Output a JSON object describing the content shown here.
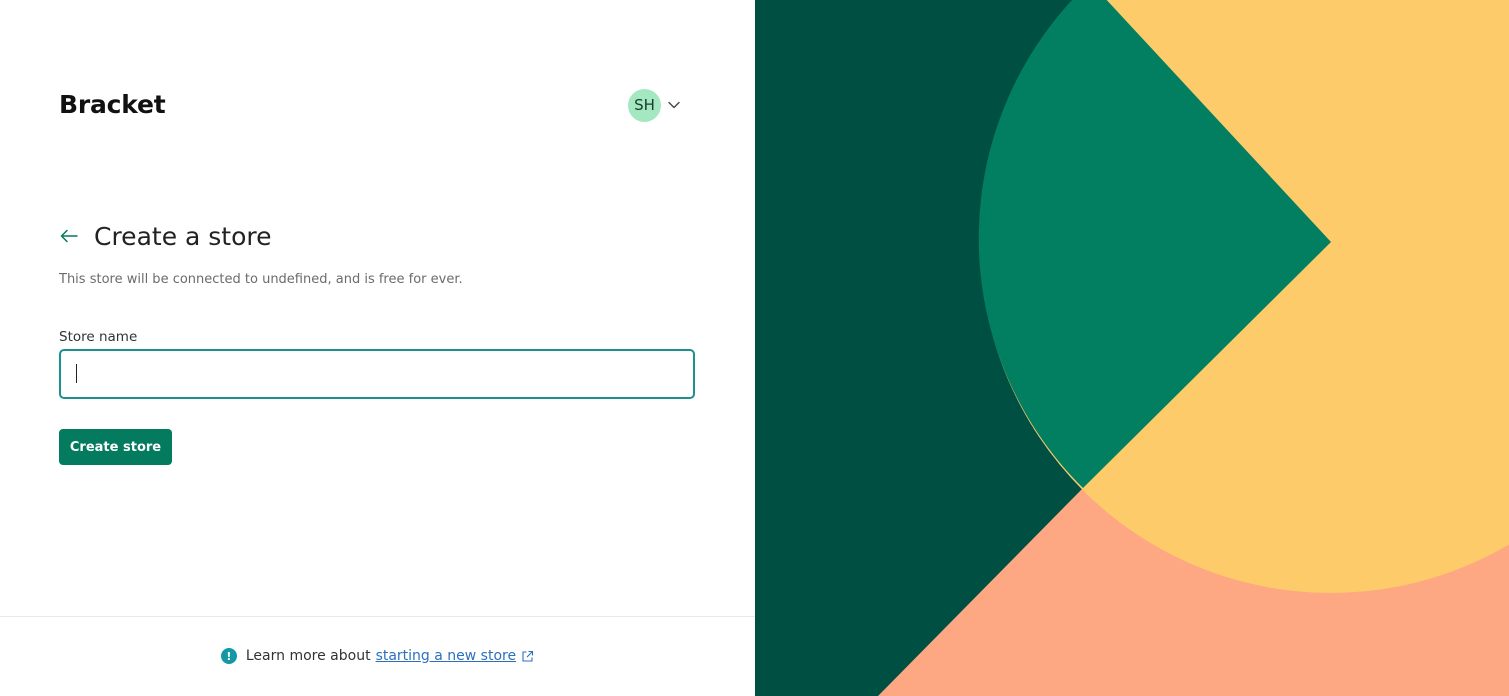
{
  "header": {
    "brand": "Bracket",
    "avatar_initials": "SH"
  },
  "main": {
    "title": "Create a store",
    "subtitle": "This store will be connected to undefined, and is free for ever.",
    "store_name_label": "Store name",
    "store_name_value": "",
    "store_name_placeholder": "",
    "submit_label": "Create store"
  },
  "footer": {
    "prefix": "Learn more about",
    "link_label": "starting a new store"
  },
  "icons": {
    "back": "arrow-left-icon",
    "account_menu": "chevron-down-icon",
    "info": "info-icon",
    "external": "external-link-icon"
  },
  "colors": {
    "accent": "#047a5e",
    "focus_border": "#1d8f8f",
    "avatar_bg": "#a3e8c0",
    "info": "#1598a6",
    "link": "#2d6fbf",
    "art_dark_green": "#004f43",
    "art_green": "#027f60",
    "art_yellow": "#fdcb6a",
    "art_salmon": "#fea783"
  }
}
